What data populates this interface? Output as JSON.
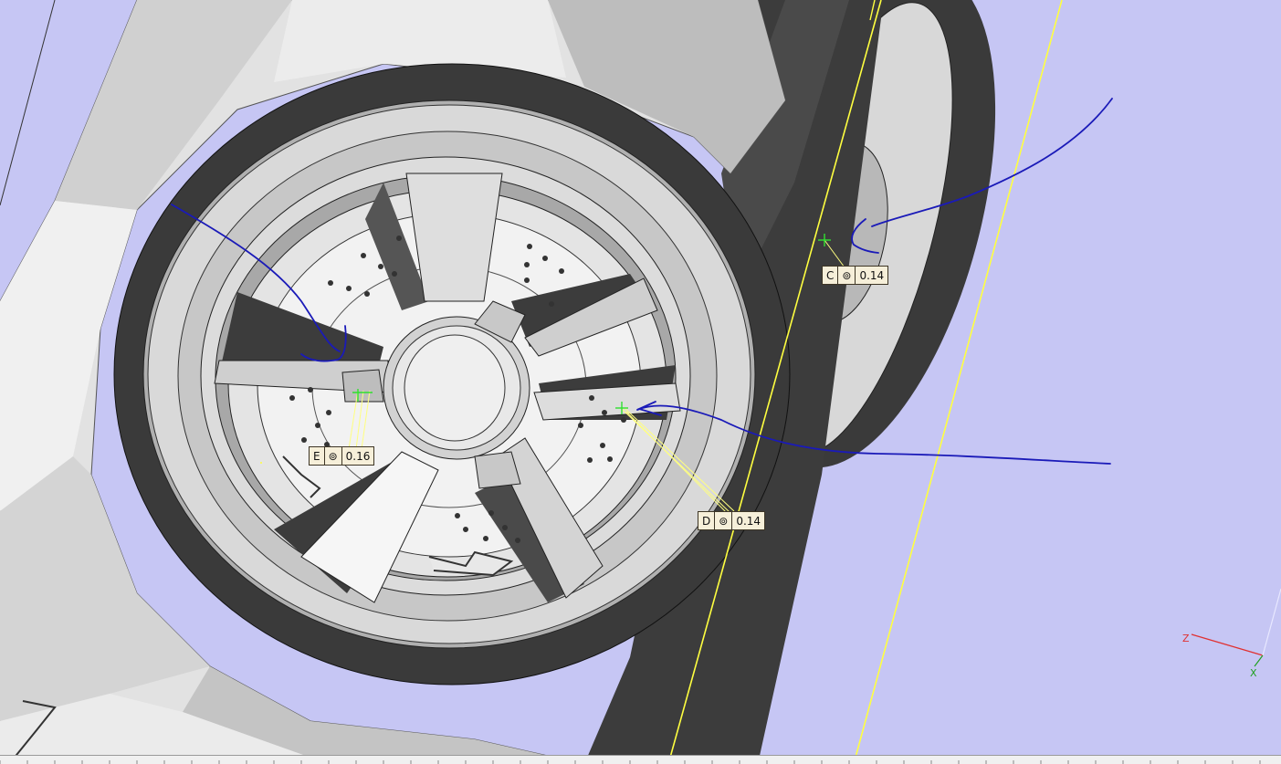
{
  "annotations": [
    {
      "id": "C",
      "symbol": "⊚",
      "value": "0.14"
    },
    {
      "id": "D",
      "symbol": "⊚",
      "value": "0.14"
    },
    {
      "id": "E",
      "symbol": "⊚",
      "value": "0.16"
    }
  ],
  "axis_triad": {
    "z_label": "Z",
    "x_label": "X"
  },
  "colors": {
    "background": "#c6c6f4",
    "section_line": "#ffff40",
    "leader_line": "#ffff80",
    "markup": "#1a1ab8",
    "datum_marker": "#30e030",
    "axis_z": "#e03030",
    "axis_x": "#20a020"
  }
}
